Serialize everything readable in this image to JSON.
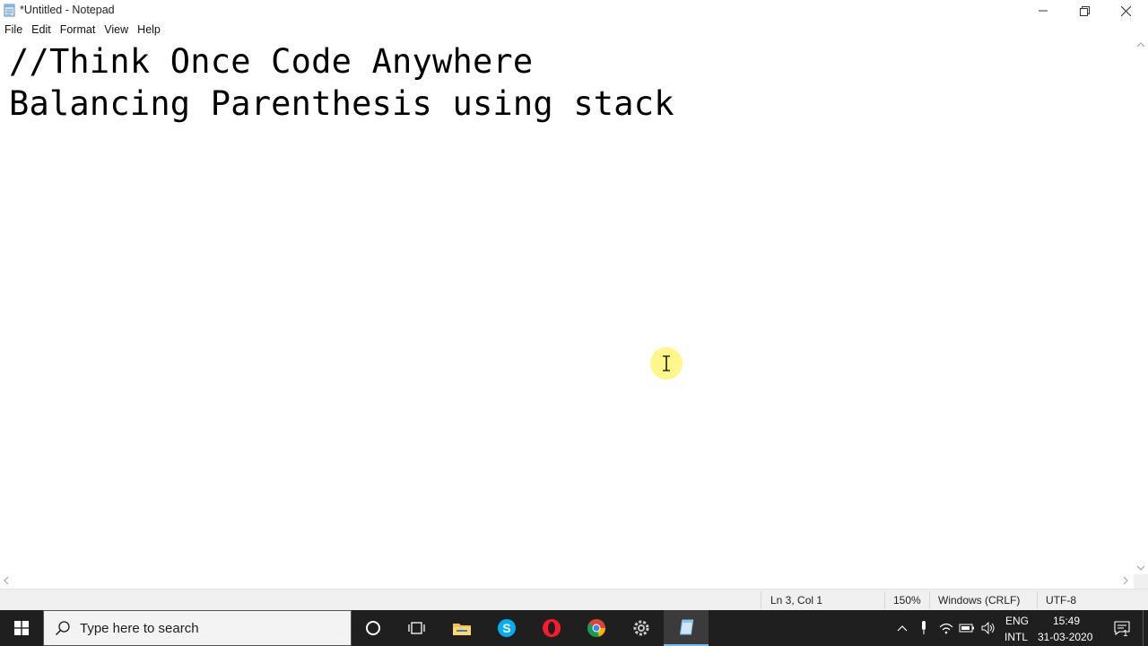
{
  "window": {
    "title": "*Untitled - Notepad"
  },
  "menu": {
    "items": [
      "File",
      "Edit",
      "Format",
      "View",
      "Help"
    ]
  },
  "editor": {
    "lines": [
      "//Think Once Code Anywhere",
      "Balancing Parenthesis using stack"
    ]
  },
  "status": {
    "position": "Ln 3, Col 1",
    "zoom": "150%",
    "line_ending": "Windows (CRLF)",
    "encoding": "UTF-8"
  },
  "taskbar": {
    "search_placeholder": "Type here to search",
    "apps": [
      "cortana-icon",
      "task-view-icon",
      "file-explorer-icon",
      "skype-icon",
      "opera-icon",
      "chrome-icon",
      "settings-icon",
      "notepad-icon"
    ],
    "tray": {
      "lang_top": "ENG",
      "lang_bottom": "INTL",
      "time": "15:49",
      "date": "31-03-2020",
      "notification_count": "1"
    }
  },
  "colors": {
    "taskbar_bg": "#1f1f1f",
    "accent": "#76b9ed",
    "cursor_highlight": "#fff578"
  }
}
